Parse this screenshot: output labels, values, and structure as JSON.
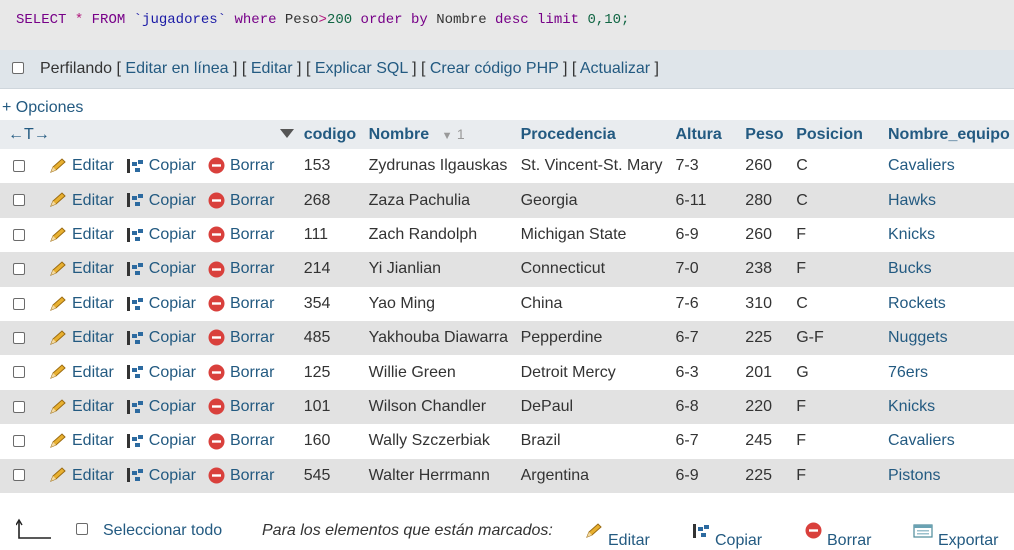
{
  "sql": {
    "select": "SELECT",
    "star": "*",
    "from": "FROM",
    "table": "`jugadores`",
    "where": "where",
    "field": "Peso",
    "gt": ">",
    "value": "200",
    "order": "order",
    "by": "by",
    "orderfield": "Nombre",
    "desc": "desc",
    "limit": "limit",
    "limitvals": "0,10;"
  },
  "toolbar": {
    "profiling": "Perfilando",
    "edit_inline": "Editar en línea",
    "edit": "Editar",
    "explain": "Explicar SQL",
    "php": "Crear código PHP",
    "refresh": "Actualizar"
  },
  "options_link": "+ Opciones",
  "columns": {
    "arrows": "←T→",
    "codigo": "codigo",
    "nombre": "Nombre",
    "sort_order": "1",
    "procedencia": "Procedencia",
    "altura": "Altura",
    "peso": "Peso",
    "posicion": "Posicion",
    "equipo": "Nombre_equipo"
  },
  "actions": {
    "edit": "Editar",
    "copy": "Copiar",
    "delete": "Borrar"
  },
  "rows": [
    {
      "codigo": "153",
      "nombre": "Zydrunas Ilgauskas",
      "procedencia": "St. Vincent-St. Mary",
      "altura": "7-3",
      "peso": "260",
      "posicion": "C",
      "equipo": "Cavaliers"
    },
    {
      "codigo": "268",
      "nombre": "Zaza Pachulia",
      "procedencia": "Georgia",
      "altura": "6-11",
      "peso": "280",
      "posicion": "C",
      "equipo": "Hawks"
    },
    {
      "codigo": "111",
      "nombre": "Zach Randolph",
      "procedencia": "Michigan State",
      "altura": "6-9",
      "peso": "260",
      "posicion": "F",
      "equipo": "Knicks"
    },
    {
      "codigo": "214",
      "nombre": "Yi Jianlian",
      "procedencia": "Connecticut",
      "altura": "7-0",
      "peso": "238",
      "posicion": "F",
      "equipo": "Bucks"
    },
    {
      "codigo": "354",
      "nombre": "Yao Ming",
      "procedencia": "China",
      "altura": "7-6",
      "peso": "310",
      "posicion": "C",
      "equipo": "Rockets"
    },
    {
      "codigo": "485",
      "nombre": "Yakhouba Diawarra",
      "procedencia": "Pepperdine",
      "altura": "6-7",
      "peso": "225",
      "posicion": "G-F",
      "equipo": "Nuggets"
    },
    {
      "codigo": "125",
      "nombre": "Willie Green",
      "procedencia": "Detroit Mercy",
      "altura": "6-3",
      "peso": "201",
      "posicion": "G",
      "equipo": "76ers"
    },
    {
      "codigo": "101",
      "nombre": "Wilson Chandler",
      "procedencia": "DePaul",
      "altura": "6-8",
      "peso": "220",
      "posicion": "F",
      "equipo": "Knicks"
    },
    {
      "codigo": "160",
      "nombre": "Wally Szczerbiak",
      "procedencia": "Brazil",
      "altura": "6-7",
      "peso": "245",
      "posicion": "F",
      "equipo": "Cavaliers"
    },
    {
      "codigo": "545",
      "nombre": "Walter Herrmann",
      "procedencia": "Argentina",
      "altura": "6-9",
      "peso": "225",
      "posicion": "F",
      "equipo": "Pistons"
    }
  ],
  "bottom": {
    "select_all": "Seleccionar todo",
    "marked": "Para los elementos que están marcados:",
    "edit": "Editar",
    "copy": "Copiar",
    "delete": "Borrar",
    "export": "Exportar"
  }
}
